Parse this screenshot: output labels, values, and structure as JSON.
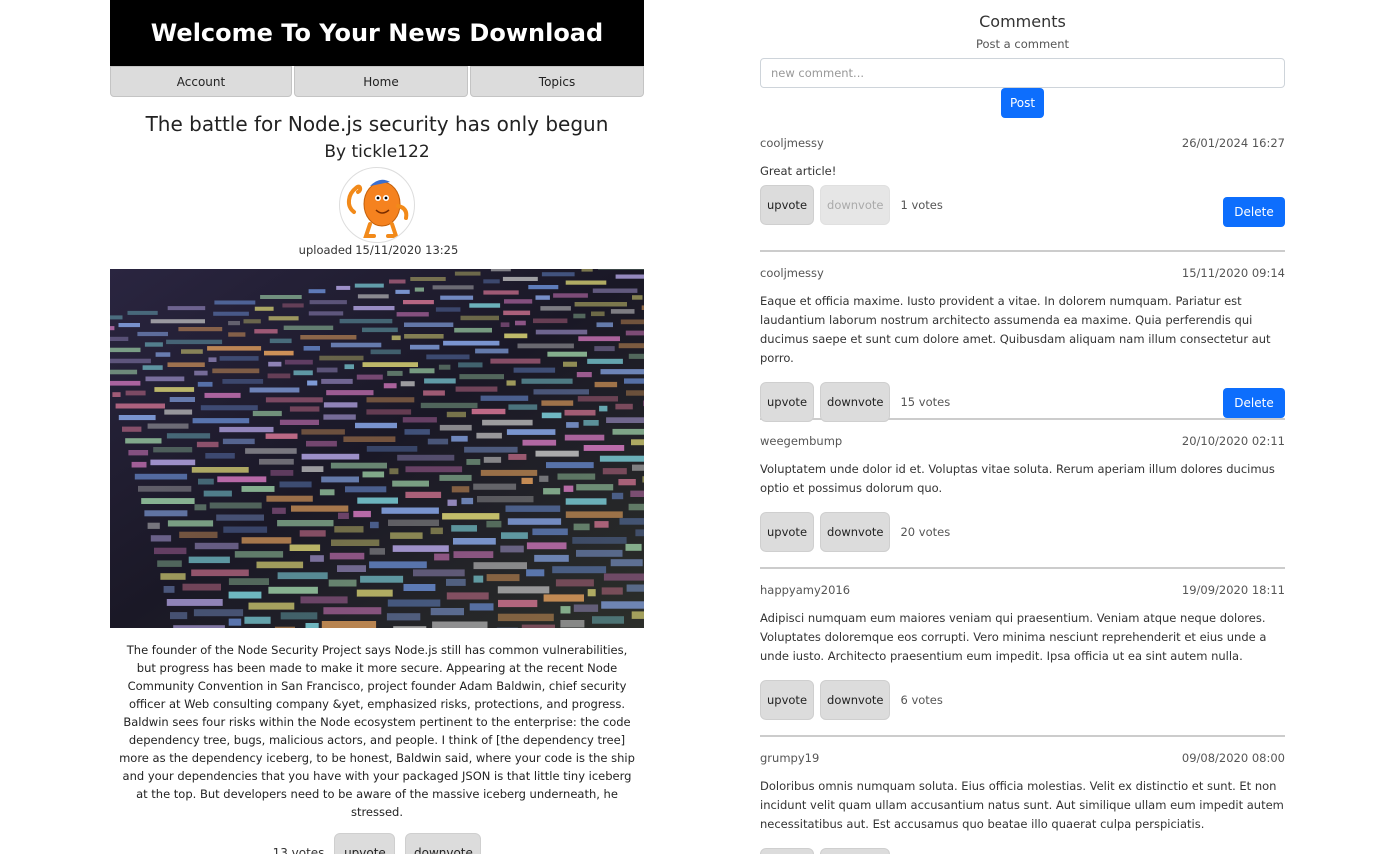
{
  "header": {
    "title": "Welcome To Your News Download"
  },
  "nav": [
    {
      "label": "Account"
    },
    {
      "label": "Home"
    },
    {
      "label": "Topics"
    }
  ],
  "article": {
    "title": "The battle for Node.js security has only begun",
    "author": "By tickle122",
    "uploaded_label": "uploaded",
    "uploaded_at": "15/11/2020 13:25",
    "body": "The founder of the Node Security Project says Node.js still has common vulnerabilities, but progress has been made to make it more secure. Appearing at the recent Node Community Convention in San Francisco, project founder Adam Baldwin, chief security officer at Web consulting company &yet, emphasized risks, protections, and progress. Baldwin sees four risks within the Node ecosystem pertinent to the enterprise: the code dependency tree, bugs, malicious actors, and people. I think of [the dependency tree] more as the dependency iceberg, to be honest, Baldwin said, where your code is the ship and your dependencies that you have with your packaged JSON is that little tiny iceberg at the top. But developers need to be aware of the massive iceberg underneath, he stressed.",
    "votes": "13 votes",
    "upvote_label": "upvote",
    "downvote_label": "downvote"
  },
  "comments_section": {
    "heading": "Comments",
    "subheading": "Post a comment",
    "input_placeholder": "new comment...",
    "post_label": "Post",
    "upvote_label": "upvote",
    "downvote_label": "downvote",
    "delete_label": "Delete",
    "items": [
      {
        "author": "cooljmessy",
        "date": "26/01/2024 16:27",
        "body": "Great article!",
        "votes": "1 votes",
        "can_delete": true,
        "downvote_disabled": true
      },
      {
        "author": "cooljmessy",
        "date": "15/11/2020 09:14",
        "body": "Eaque et officia maxime. Iusto provident a vitae. In dolorem numquam. Pariatur est laudantium laborum nostrum architecto assumenda ea maxime. Quia perferendis qui ducimus saepe et sunt cum dolore amet. Quibusdam aliquam nam illum consectetur aut porro.",
        "votes": "15 votes",
        "can_delete": true,
        "downvote_disabled": false
      },
      {
        "author": "weegembump",
        "date": "20/10/2020 02:11",
        "body": "Voluptatem unde dolor id et. Voluptas vitae soluta. Rerum aperiam illum dolores ducimus optio et possimus dolorum quo.",
        "votes": "20 votes",
        "can_delete": false,
        "downvote_disabled": false
      },
      {
        "author": "happyamy2016",
        "date": "19/09/2020 18:11",
        "body": "Adipisci numquam eum maiores veniam qui praesentium. Veniam atque neque dolores. Voluptates doloremque eos corrupti. Vero minima nesciunt reprehenderit et eius unde a unde iusto. Architecto praesentium eum impedit. Ipsa officia ut ea sint autem nulla.",
        "votes": "6 votes",
        "can_delete": false,
        "downvote_disabled": false
      },
      {
        "author": "grumpy19",
        "date": "09/08/2020 08:00",
        "body": "Doloribus omnis numquam soluta. Eius officia molestias. Velit ex distinctio et sunt. Et non incidunt velit quam ullam accusantium natus sunt. Aut similique ullam eum impedit autem necessitatibus aut. Est accusamus quo beatae illo quaerat culpa perspiciatis.",
        "votes": "",
        "can_delete": false,
        "downvote_disabled": false
      }
    ]
  },
  "colors": {
    "accent": "#0d6efd",
    "banner": "#000000",
    "button_gray": "#dcdcdc"
  }
}
